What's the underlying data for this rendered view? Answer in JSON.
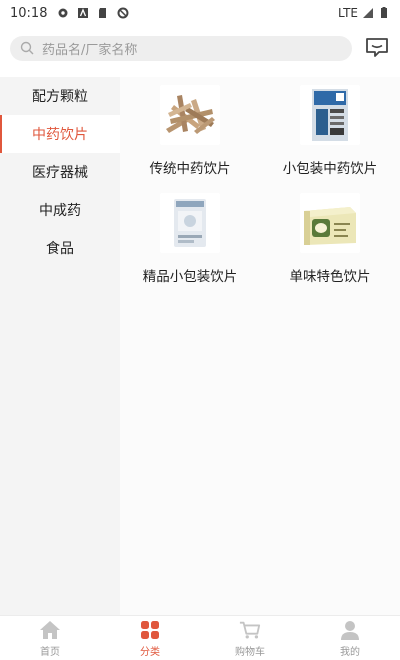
{
  "status_bar": {
    "time": "10:18",
    "network": "LTE"
  },
  "search": {
    "placeholder": "药品名/厂家名称"
  },
  "sidebar": {
    "items": [
      {
        "label": "配方颗粒"
      },
      {
        "label": "中药饮片"
      },
      {
        "label": "医疗器械"
      },
      {
        "label": "中成药"
      },
      {
        "label": "食品"
      }
    ],
    "active_index": 1
  },
  "products": [
    {
      "label": "传统中药饮片",
      "icon": "herb-slices-image"
    },
    {
      "label": "小包装中药饮片",
      "icon": "small-package-image"
    },
    {
      "label": "精品小包装饮片",
      "icon": "premium-package-image"
    },
    {
      "label": "单味特色饮片",
      "icon": "gift-box-image"
    }
  ],
  "bottom_nav": {
    "items": [
      {
        "label": "首页",
        "icon": "home-icon"
      },
      {
        "label": "分类",
        "icon": "category-icon"
      },
      {
        "label": "购物车",
        "icon": "cart-icon"
      },
      {
        "label": "我的",
        "icon": "user-icon"
      }
    ],
    "active_index": 1
  },
  "colors": {
    "accent": "#e0573c",
    "sidebar_bg": "#f4f4f4",
    "search_bg": "#eeeeee"
  }
}
